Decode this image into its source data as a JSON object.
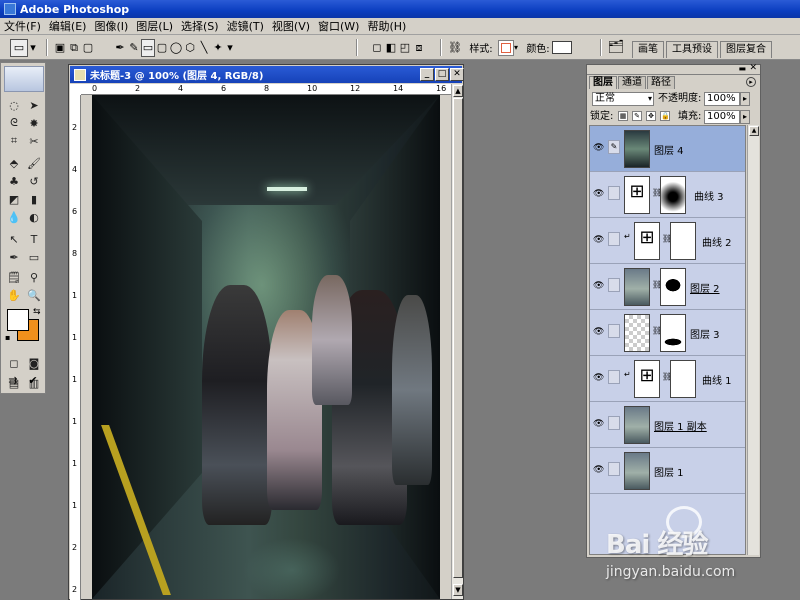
{
  "app": {
    "title": "Adobe Photoshop"
  },
  "menu": [
    "文件(F)",
    "编辑(E)",
    "图像(I)",
    "图层(L)",
    "选择(S)",
    "滤镜(T)",
    "视图(V)",
    "窗口(W)",
    "帮助(H)"
  ],
  "options": {
    "style_label": "样式:",
    "color_label": "颜色:"
  },
  "palette_well_tabs": [
    "画笔",
    "工具预设",
    "图层复合"
  ],
  "document": {
    "title": "未标题-3 @ 100% (图层 4, RGB/8)",
    "hruler": [
      "0",
      "2",
      "4",
      "6",
      "8",
      "10",
      "12",
      "14",
      "16"
    ],
    "vruler": [
      "2",
      "4",
      "6",
      "8",
      "1",
      "1",
      "1",
      "1",
      "1",
      "1",
      "2",
      "2",
      "2"
    ]
  },
  "layers_panel": {
    "tabs": [
      "图层",
      "通道",
      "路径"
    ],
    "blend_mode": "正常",
    "opacity_label": "不透明度:",
    "opacity_value": "100%",
    "lock_label": "锁定:",
    "fill_label": "填充:",
    "fill_value": "100%",
    "layers": [
      {
        "name": "图层 4",
        "type": "photo",
        "selected": true
      },
      {
        "name": "曲线 3",
        "type": "curves"
      },
      {
        "name": "曲线 2",
        "type": "curves"
      },
      {
        "name": "图层 2",
        "type": "photo-mask"
      },
      {
        "name": "图层 3",
        "type": "check-mask"
      },
      {
        "name": "曲线 1",
        "type": "curves"
      },
      {
        "name": "图层 1 副本",
        "type": "photo2"
      },
      {
        "name": "图层 1",
        "type": "photo2"
      }
    ]
  },
  "watermark": {
    "brand": "Bai 经验",
    "url": "jingyan.baidu.com"
  }
}
